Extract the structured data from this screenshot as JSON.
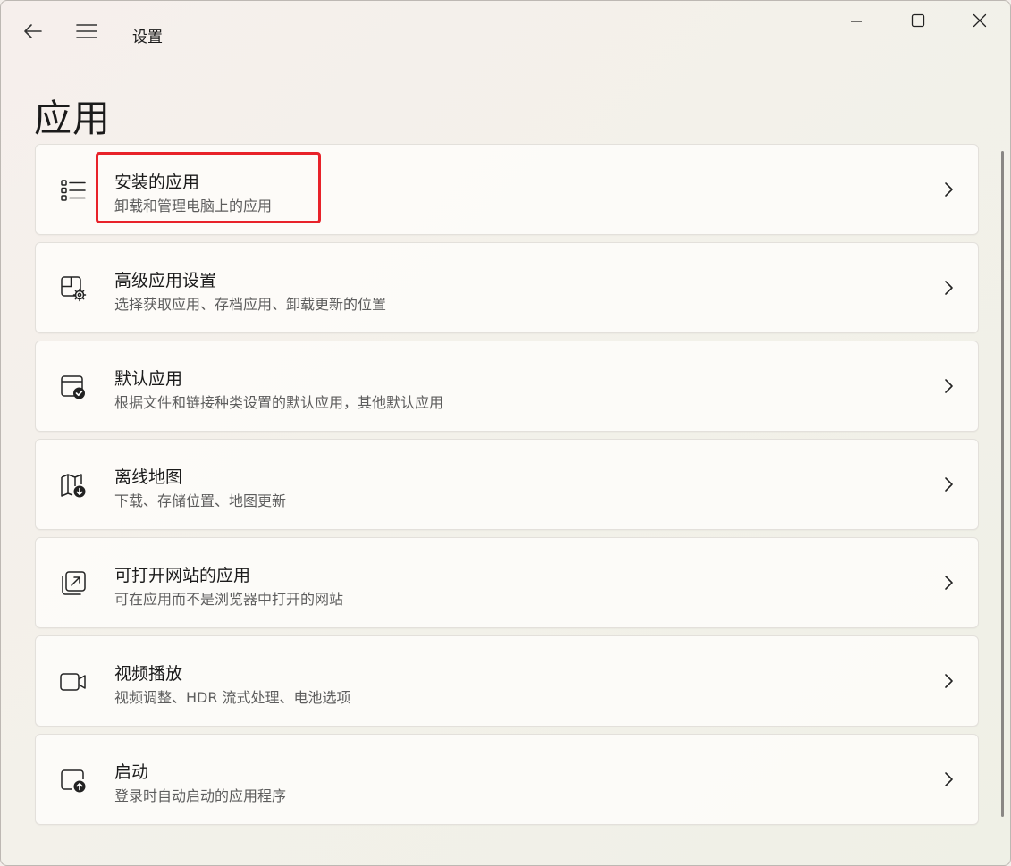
{
  "window": {
    "app_title": "设置",
    "back_icon": "back-arrow-icon",
    "menu_icon": "hamburger-menu-icon",
    "controls": [
      "minimize-icon",
      "maximize-icon",
      "close-icon"
    ]
  },
  "page": {
    "title": "应用"
  },
  "items": [
    {
      "icon": "list-icon",
      "title": "安装的应用",
      "subtitle": "卸载和管理电脑上的应用"
    },
    {
      "icon": "app-settings-icon",
      "title": "高级应用设置",
      "subtitle": "选择获取应用、存档应用、卸载更新的位置"
    },
    {
      "icon": "default-app-icon",
      "title": "默认应用",
      "subtitle": "根据文件和链接种类设置的默认应用，其他默认应用"
    },
    {
      "icon": "offline-map-icon",
      "title": "离线地图",
      "subtitle": "下载、存储位置、地图更新"
    },
    {
      "icon": "open-website-icon",
      "title": "可打开网站的应用",
      "subtitle": "可在应用而不是浏览器中打开的网站"
    },
    {
      "icon": "video-icon",
      "title": "视频播放",
      "subtitle": "视频调整、HDR 流式处理、电池选项"
    },
    {
      "icon": "startup-icon",
      "title": "启动",
      "subtitle": "登录时自动启动的应用程序"
    }
  ],
  "colors": {
    "highlight": "#e8222a",
    "text_primary": "#1b1b1b",
    "text_secondary": "#5d5d5d"
  }
}
